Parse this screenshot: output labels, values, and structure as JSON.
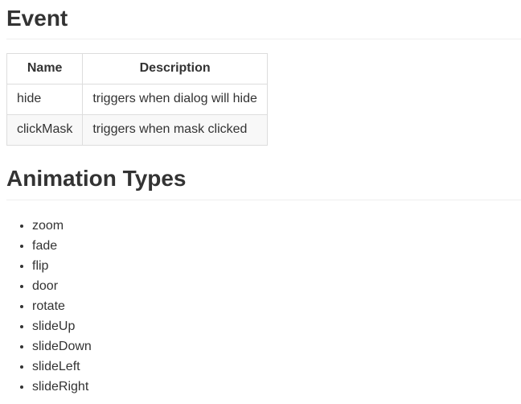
{
  "event": {
    "heading": "Event",
    "columns": [
      "Name",
      "Description"
    ],
    "rows": [
      [
        "hide",
        "triggers when dialog will hide"
      ],
      [
        "clickMask",
        "triggers when mask clicked"
      ]
    ]
  },
  "animation": {
    "heading": "Animation Types",
    "items": [
      "zoom",
      "fade",
      "flip",
      "door",
      "rotate",
      "slideUp",
      "slideDown",
      "slideLeft",
      "slideRight"
    ]
  }
}
